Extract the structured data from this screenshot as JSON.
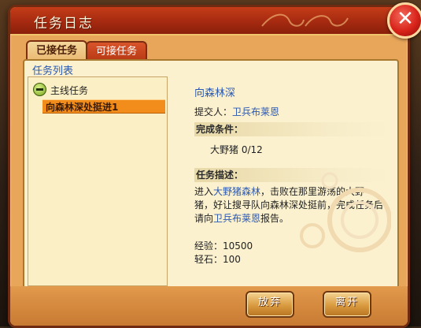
{
  "window": {
    "title": "任务日志"
  },
  "tabs": [
    {
      "label": "已接任务",
      "active": true
    },
    {
      "label": "可接任务",
      "active": false
    }
  ],
  "quest_list": {
    "label": "任务列表",
    "group": {
      "label": "主线任务",
      "expanded": true
    },
    "items": [
      {
        "label": "向森林深处挺进1",
        "selected": true
      }
    ]
  },
  "detail": {
    "title": "向森林深",
    "submitter_label": "提交人：",
    "submitter_name": "卫兵布莱恩",
    "completion_header": "完成条件：",
    "goal": "大野猪 0/12",
    "description_header": "任务描述：",
    "description": {
      "p1": "进入",
      "hl1": "大野猪森林",
      "p2": "，击败在那里游荡的大野猪，好让搜寻队向森林深处挺前，完成任务后请向",
      "hl2": "卫兵布莱恩",
      "p3": "报告。"
    },
    "rewards": [
      {
        "label": "经验：",
        "value": "10500"
      },
      {
        "label": "轻石：",
        "value": "100"
      }
    ]
  },
  "buttons": {
    "abandon": "放弃",
    "leave": "离开"
  },
  "colors": {
    "title_bar": "#b5300f",
    "link": "#2a58b0",
    "selected_item": "#f28c1a"
  }
}
